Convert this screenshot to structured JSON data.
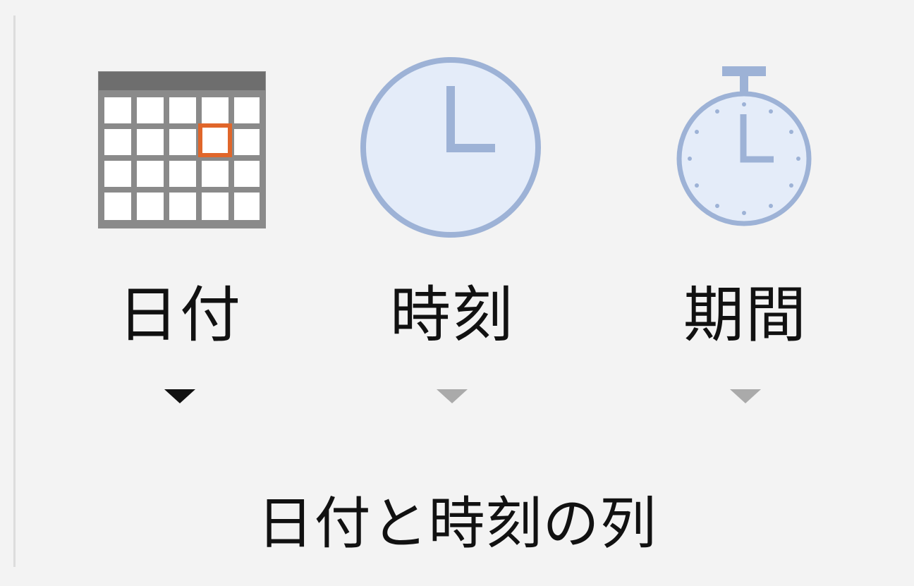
{
  "ribbon_group": {
    "title": "日付と時刻の列",
    "buttons": [
      {
        "label": "日付",
        "icon": "calendar-icon",
        "enabled": true
      },
      {
        "label": "時刻",
        "icon": "clock-icon",
        "enabled": false
      },
      {
        "label": "期間",
        "icon": "stopwatch-icon",
        "enabled": false
      }
    ]
  },
  "colors": {
    "background": "#f3f3f3",
    "text": "#111111",
    "disabled_arrow": "#aaaaaa",
    "calendar_highlight": "#e0662a",
    "clock_stroke": "#9db2d6",
    "clock_fill": "#e4ecf9"
  }
}
